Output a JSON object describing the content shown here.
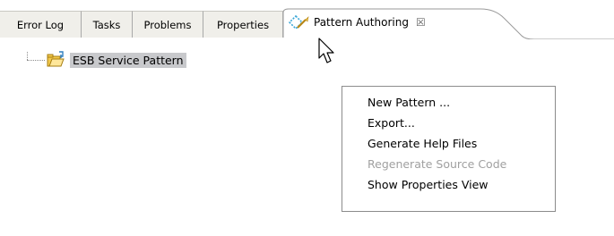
{
  "tabs": [
    {
      "label": "Error Log"
    },
    {
      "label": "Tasks"
    },
    {
      "label": "Problems"
    },
    {
      "label": "Properties"
    }
  ],
  "active_tab": {
    "label": "Pattern Authoring",
    "close_glyph": "☒"
  },
  "tree": {
    "item_label": "ESB Service Pattern"
  },
  "context_menu": {
    "items": [
      {
        "label": "New Pattern ...",
        "enabled": true
      },
      {
        "label": "Export...",
        "enabled": true
      },
      {
        "label": "Generate Help Files",
        "enabled": true
      },
      {
        "label": "Regenerate Source Code",
        "enabled": false
      },
      {
        "label": "Show Properties View",
        "enabled": true
      }
    ]
  },
  "colors": {
    "tab_bg": "#f0efea",
    "selection_bg": "#c8c9cc",
    "disabled_text": "#a0a0a0",
    "folder_yellow": "#f2c94c"
  }
}
